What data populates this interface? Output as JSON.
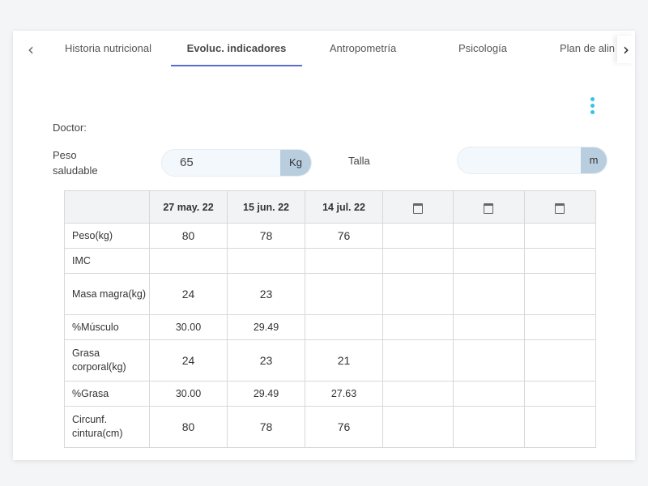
{
  "tabs": [
    {
      "label": "Historia nutricional",
      "active": false
    },
    {
      "label": "Evoluc. indicadores",
      "active": true
    },
    {
      "label": "Antropometría",
      "active": false
    },
    {
      "label": "Psicología",
      "active": false
    },
    {
      "label": "Plan de alin",
      "active": false
    }
  ],
  "nav": {
    "prev": "‹",
    "next": "›"
  },
  "form": {
    "doctor_label": "Doctor:",
    "peso_label_line1": "Peso",
    "peso_label_line2": "saludable",
    "peso_value": "65",
    "peso_unit": "Kg",
    "talla_label": "Talla",
    "talla_value": "",
    "talla_unit": "m"
  },
  "table": {
    "columns": [
      "",
      "27 may. 22",
      "15 jun. 22",
      "14 jul. 22",
      "",
      "",
      ""
    ],
    "rows": [
      {
        "label": "Peso(kg)",
        "values": [
          "80",
          "78",
          "76",
          "",
          "",
          ""
        ]
      },
      {
        "label": "IMC",
        "values": [
          "",
          "",
          "",
          "",
          "",
          ""
        ]
      },
      {
        "label": "Masa magra(kg)",
        "values": [
          "24",
          "23",
          "",
          "",
          "",
          ""
        ]
      },
      {
        "label": "%Músculo",
        "values": [
          "30.00",
          "29.49",
          "",
          "",
          "",
          ""
        ]
      },
      {
        "label": "Grasa corporal(kg)",
        "values": [
          "24",
          "23",
          "21",
          "",
          "",
          ""
        ]
      },
      {
        "label": "%Grasa",
        "values": [
          "30.00",
          "29.49",
          "27.63",
          "",
          "",
          ""
        ]
      },
      {
        "label": "Circunf. cintura(cm)",
        "values": [
          "80",
          "78",
          "76",
          "",
          "",
          ""
        ]
      }
    ]
  },
  "icons": {
    "calendar": "calendar-icon",
    "menu": "more-vertical-icon"
  },
  "colors": {
    "accent": "#5b6bd1",
    "kebab": "#36c3e6",
    "unit_bg": "#b8cede"
  }
}
